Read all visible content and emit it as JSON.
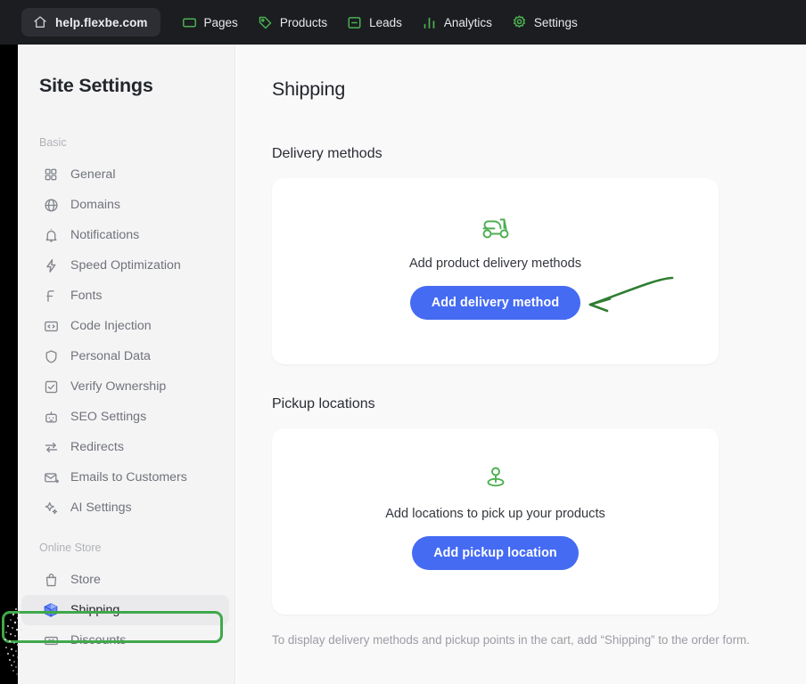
{
  "topbar": {
    "site_chip": {
      "label": "help.flexbe.com",
      "icon": "home-icon"
    },
    "nav": [
      {
        "label": "Pages",
        "icon": "pages-icon"
      },
      {
        "label": "Products",
        "icon": "tag-icon"
      },
      {
        "label": "Leads",
        "icon": "inbox-icon"
      },
      {
        "label": "Analytics",
        "icon": "bar-chart-icon"
      },
      {
        "label": "Settings",
        "icon": "gear-icon"
      }
    ],
    "colors": {
      "background": "#1b1d21",
      "chip_background": "#2c2e33",
      "icon_accent": "#4caf50"
    }
  },
  "sidebar": {
    "title": "Site Settings",
    "groups": [
      {
        "label": "Basic",
        "items": [
          {
            "label": "General",
            "icon": "grid-icon"
          },
          {
            "label": "Domains",
            "icon": "globe-icon"
          },
          {
            "label": "Notifications",
            "icon": "bell-icon"
          },
          {
            "label": "Speed Optimization",
            "icon": "bolt-icon"
          },
          {
            "label": "Fonts",
            "icon": "font-icon"
          },
          {
            "label": "Code Injection",
            "icon": "code-icon"
          },
          {
            "label": "Personal Data",
            "icon": "shield-icon"
          },
          {
            "label": "Verify Ownership",
            "icon": "checkbox-icon"
          },
          {
            "label": "SEO Settings",
            "icon": "robot-icon"
          },
          {
            "label": "Redirects",
            "icon": "arrows-swap-icon"
          },
          {
            "label": "Emails to Customers",
            "icon": "envelope-icon"
          },
          {
            "label": "AI Settings",
            "icon": "sparkle-icon"
          }
        ]
      },
      {
        "label": "Online Store",
        "items": [
          {
            "label": "Store",
            "icon": "shopping-bag-icon"
          },
          {
            "label": "Shipping",
            "icon": "package-box-icon",
            "active": true
          },
          {
            "label": "Discounts",
            "icon": "ticket-icon"
          }
        ]
      }
    ]
  },
  "main": {
    "page_title": "Shipping",
    "sections": [
      {
        "heading": "Delivery methods",
        "card": {
          "icon": "scooter-icon",
          "text": "Add product delivery methods",
          "button_label": "Add delivery method"
        }
      },
      {
        "heading": "Pickup locations",
        "card": {
          "icon": "map-pin-icon",
          "text": "Add locations to pick up your products",
          "button_label": "Add pickup location"
        }
      }
    ],
    "footnote": "To display delivery methods and pickup points in the cart, add “Shipping” to the order form."
  },
  "annotations": {
    "arrow": {
      "name": "highlight-arrow",
      "color": "#2f7d32",
      "points_to": "Add delivery method"
    },
    "highlight_box": {
      "name": "highlight-box",
      "color": "#40a84a",
      "target": "Shipping"
    }
  },
  "colors": {
    "primary_button": "#456bf3",
    "icon_green": "#4caf50",
    "annotation_green": "#2f7d32",
    "sidebar_bg": "#f4f4f5",
    "main_bg": "#f9f9fa",
    "card_bg": "#ffffff"
  }
}
